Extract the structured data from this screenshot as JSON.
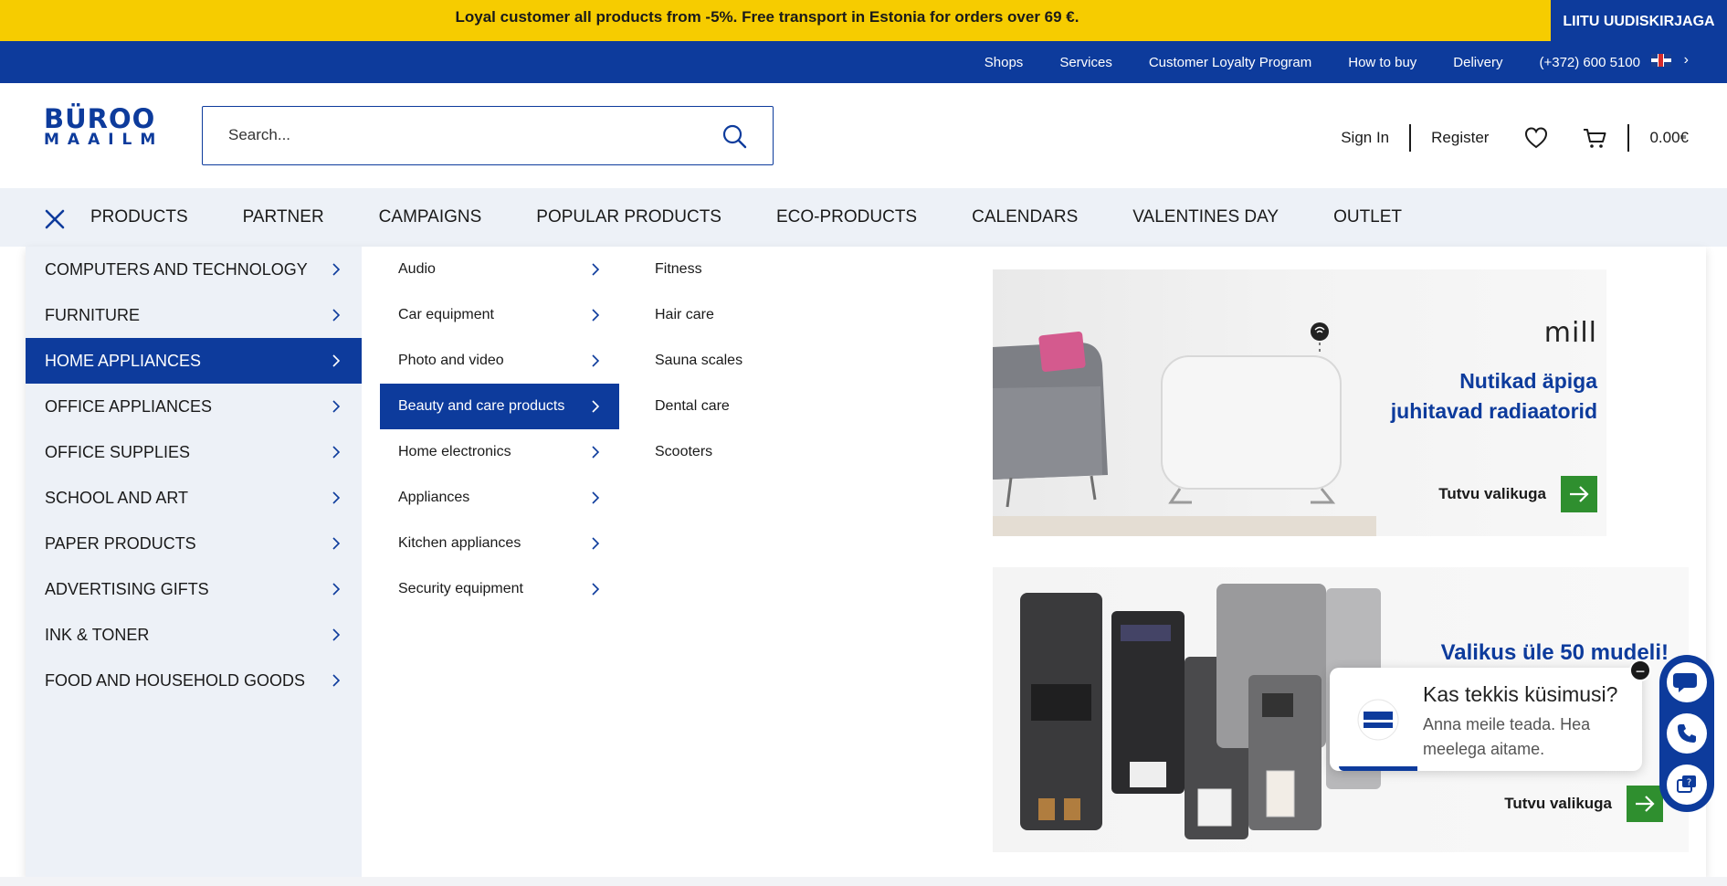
{
  "promo": {
    "text": "Loyal customer all products from -5%. Free transport in Estonia for orders over 69 €.",
    "newsletter_label": "LIITU UUDISKIRJAGA"
  },
  "topnav": {
    "links": [
      "Shops",
      "Services",
      "Customer Loyalty Program",
      "How to buy",
      "Delivery",
      "(+372) 600 5100"
    ],
    "language_icon": "uk-flag-icon"
  },
  "logo": {
    "line1": "BÜROO",
    "line2": "MAAILM"
  },
  "search": {
    "placeholder": "Search...",
    "value": ""
  },
  "account": {
    "sign_in": "Sign In",
    "register": "Register",
    "cart_total": "0.00€"
  },
  "catbar": {
    "items": [
      "PRODUCTS",
      "PARTNER",
      "CAMPAIGNS",
      "POPULAR PRODUCTS",
      "ECO-PRODUCTS",
      "CALENDARS",
      "VALENTINES DAY",
      "OUTLET"
    ]
  },
  "menu": {
    "level1": [
      {
        "label": "COMPUTERS AND TECHNOLOGY",
        "active": false
      },
      {
        "label": "FURNITURE",
        "active": false
      },
      {
        "label": "HOME APPLIANCES",
        "active": true
      },
      {
        "label": "OFFICE APPLIANCES",
        "active": false
      },
      {
        "label": "OFFICE SUPPLIES",
        "active": false
      },
      {
        "label": "SCHOOL AND ART",
        "active": false
      },
      {
        "label": "PAPER PRODUCTS",
        "active": false
      },
      {
        "label": "ADVERTISING GIFTS",
        "active": false
      },
      {
        "label": "INK & TONER",
        "active": false
      },
      {
        "label": "FOOD AND HOUSEHOLD GOODS",
        "active": false
      }
    ],
    "level2": [
      {
        "label": "Audio",
        "active": false
      },
      {
        "label": "Car equipment",
        "active": false
      },
      {
        "label": "Photo and video",
        "active": false
      },
      {
        "label": "Beauty and care products",
        "active": true
      },
      {
        "label": "Home electronics",
        "active": false
      },
      {
        "label": "Appliances",
        "active": false
      },
      {
        "label": "Kitchen appliances",
        "active": false
      },
      {
        "label": "Security equipment",
        "active": false
      }
    ],
    "level3": [
      "Fitness",
      "Hair care",
      "Sauna scales",
      "Dental care",
      "Scooters"
    ]
  },
  "banners": {
    "banner1": {
      "brand": "mill",
      "headline_line1": "Nutikad äpiga",
      "headline_line2": "juhitavad radiaatorid",
      "cta": "Tutvu valikuga"
    },
    "banner2": {
      "headline": "Valikus üle 50 mudeli!",
      "cta": "Tutvu valikuga"
    }
  },
  "chat": {
    "title": "Kas tekkis küsimusi?",
    "subtitle": "Anna meile teada. Hea meelega aitame.",
    "minimize": "−"
  },
  "colors": {
    "brand_blue": "#0d3b9c",
    "promo_yellow": "#f6cc00",
    "menu_bg": "#edf1f7",
    "cta_green": "#2f8f2f"
  }
}
